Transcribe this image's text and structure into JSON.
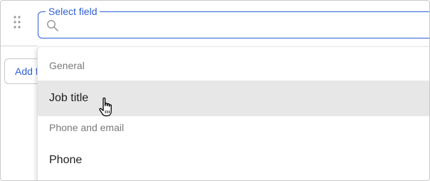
{
  "select_field": {
    "legend": "Select field",
    "search_value": ""
  },
  "add_button": {
    "label": "Add f"
  },
  "dropdown": {
    "groups": [
      {
        "label": "General",
        "items": [
          {
            "label": "Job title",
            "hovered": true
          }
        ]
      },
      {
        "label": "Phone and email",
        "items": [
          {
            "label": "Phone",
            "hovered": false
          }
        ]
      }
    ]
  },
  "colors": {
    "accent": "#2f5fd0",
    "hover_bg": "#e7e7e7",
    "group_text": "#7a7a7a"
  },
  "icons": {
    "drag": "drag-handle-icon",
    "search": "search-icon",
    "cursor": "hand-pointer-cursor-icon"
  }
}
